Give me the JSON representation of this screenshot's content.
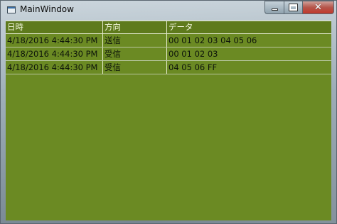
{
  "window": {
    "title": "MainWindow"
  },
  "caption_buttons": {
    "minimize": "minimize-icon",
    "maximize": "maximize-icon",
    "close": "close-icon"
  },
  "colors": {
    "grid_background": "#6b8a23",
    "header_background": "#5e7a1c",
    "header_text": "#f3f7dd"
  },
  "table": {
    "columns": [
      "日時",
      "方向",
      "データ"
    ],
    "rows": [
      [
        "4/18/2016 4:44:30 PM",
        "送信",
        "00 01 02 03 04 05 06"
      ],
      [
        "4/18/2016 4:44:30 PM",
        "受信",
        "00 01 02 03"
      ],
      [
        "4/18/2016 4:44:30 PM",
        "受信",
        "04 05 06 FF"
      ]
    ]
  }
}
